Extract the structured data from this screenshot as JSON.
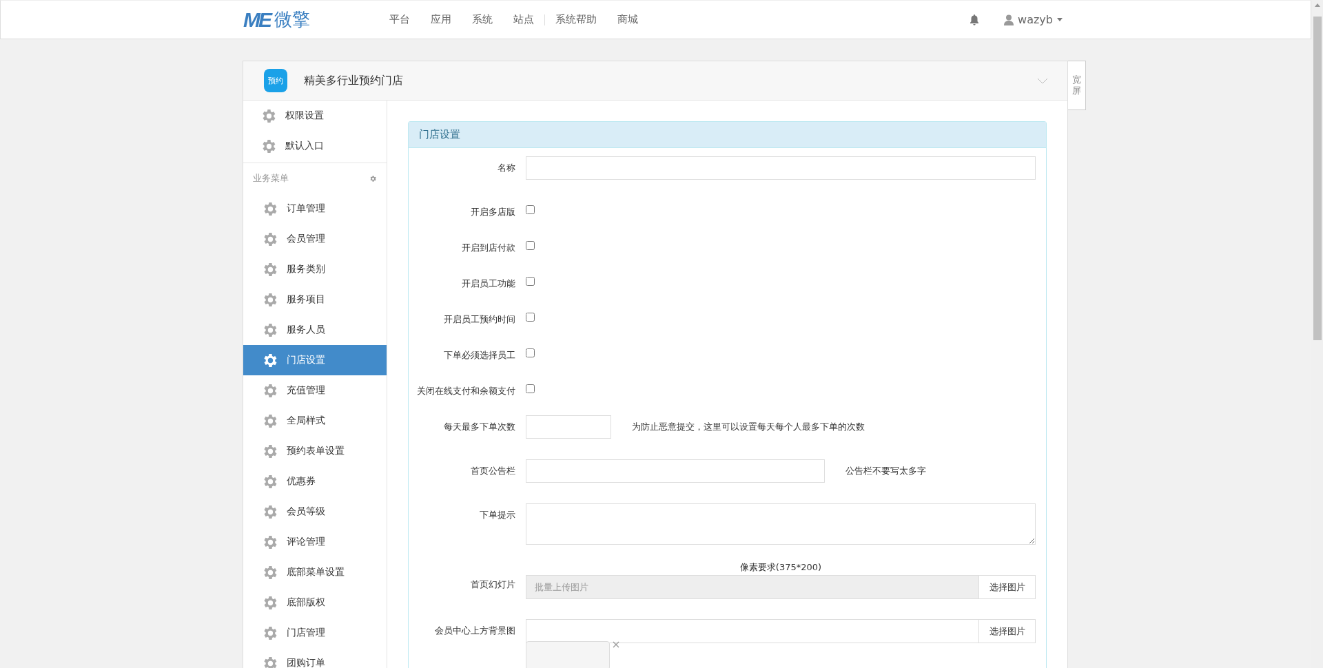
{
  "topbar": {
    "logo_mark": "ME",
    "logo_text": "微擎",
    "nav": [
      {
        "label": "平台"
      },
      {
        "label": "应用"
      },
      {
        "label": "系统"
      },
      {
        "label": "站点"
      },
      {
        "label": "系统帮助"
      },
      {
        "label": "商城"
      }
    ],
    "user": "wazyb"
  },
  "module": {
    "icon_text": "预约",
    "title": "精美多行业预约门店",
    "wide_toggle": "宽屏"
  },
  "sidebar": {
    "top_items": [
      {
        "label": "权限设置",
        "selected": false
      },
      {
        "label": "默认入口",
        "selected": false
      }
    ],
    "section": "业务菜单",
    "items": [
      {
        "label": "订单管理",
        "selected": false
      },
      {
        "label": "会员管理",
        "selected": false
      },
      {
        "label": "服务类别",
        "selected": false
      },
      {
        "label": "服务项目",
        "selected": false
      },
      {
        "label": "服务人员",
        "selected": false
      },
      {
        "label": "门店设置",
        "selected": true
      },
      {
        "label": "充值管理",
        "selected": false
      },
      {
        "label": "全局样式",
        "selected": false
      },
      {
        "label": "预约表单设置",
        "selected": false
      },
      {
        "label": "优惠券",
        "selected": false
      },
      {
        "label": "会员等级",
        "selected": false
      },
      {
        "label": "评论管理",
        "selected": false
      },
      {
        "label": "底部菜单设置",
        "selected": false
      },
      {
        "label": "底部版权",
        "selected": false
      },
      {
        "label": "门店管理",
        "selected": false
      },
      {
        "label": "团购订单",
        "selected": false
      }
    ]
  },
  "panel": {
    "title": "门店设置",
    "fields": [
      {
        "kind": "text",
        "label": "名称"
      },
      {
        "kind": "checkbox",
        "label": "开启多店版",
        "checked": false
      },
      {
        "kind": "checkbox",
        "label": "开启到店付款",
        "checked": false
      },
      {
        "kind": "checkbox",
        "label": "开启员工功能",
        "checked": false
      },
      {
        "kind": "checkbox",
        "label": "开启员工预约时间",
        "checked": false
      },
      {
        "kind": "checkbox",
        "label": "下单必须选择员工",
        "checked": false
      },
      {
        "kind": "checkbox",
        "label": "关闭在线支付和余额支付",
        "checked": false
      },
      {
        "kind": "short",
        "label": "每天最多下单次数",
        "hint": "为防止恶意提交，这里可以设置每天每个人最多下单的次数"
      },
      {
        "kind": "medium",
        "label": "首页公告栏",
        "hint": "公告栏不要写太多字"
      },
      {
        "kind": "textarea",
        "label": "下单提示"
      },
      {
        "kind": "upload",
        "label": "首页幻灯片",
        "note": "像素要求(375*200)",
        "placeholder": "批量上传图片",
        "button": "选择图片"
      },
      {
        "kind": "upload",
        "label": "会员中心上方背景图",
        "button": "选择图片",
        "thumbnail": true
      }
    ]
  }
}
